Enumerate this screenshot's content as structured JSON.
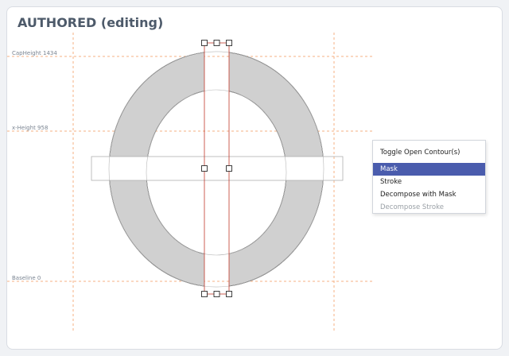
{
  "header": {
    "title": "AUTHORED (editing)"
  },
  "guides": {
    "cap_height": "CapHeight 1434",
    "x_height": "x-Height 958",
    "baseline": "Baseline 0"
  },
  "context_menu": {
    "items": [
      {
        "label": "Toggle Open Contour(s)",
        "state": "normal"
      },
      {
        "label": "Mask",
        "state": "selected"
      },
      {
        "label": "Stroke",
        "state": "normal"
      },
      {
        "label": "Decompose with Mask",
        "state": "normal"
      },
      {
        "label": "Decompose Stroke",
        "state": "disabled"
      }
    ]
  },
  "colors": {
    "guide": "#f4b183",
    "glyph_fill": "#d0d0d0",
    "mask_stroke": "#c0392b",
    "menu_selected": "#4a5cad"
  }
}
